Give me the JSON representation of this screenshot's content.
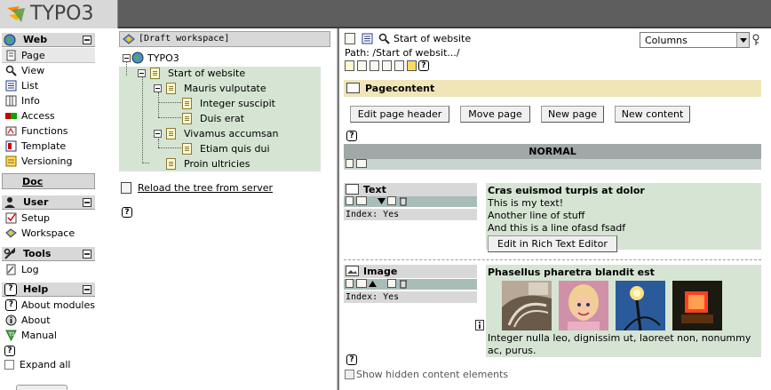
{
  "app": {
    "logo_text": "TYPO3"
  },
  "modules": {
    "web": {
      "label": "Web",
      "items": [
        {
          "label": "Page"
        },
        {
          "label": "View"
        },
        {
          "label": "List"
        },
        {
          "label": "Info"
        },
        {
          "label": "Access"
        },
        {
          "label": "Functions"
        },
        {
          "label": "Template"
        },
        {
          "label": "Versioning"
        }
      ]
    },
    "doc": {
      "label": "Doc"
    },
    "user": {
      "label": "User",
      "items": [
        {
          "label": "Setup"
        },
        {
          "label": "Workspace"
        }
      ]
    },
    "tools": {
      "label": "Tools",
      "items": [
        {
          "label": "Log"
        }
      ]
    },
    "help": {
      "label": "Help",
      "items": [
        {
          "label": "About modules"
        },
        {
          "label": "About"
        },
        {
          "label": "Manual"
        }
      ]
    },
    "expand_all": "Expand all",
    "help_icon_label": "?"
  },
  "tree": {
    "workspace": "[Draft workspace]",
    "nodes": {
      "root": "TYPO3",
      "start": "Start of website",
      "mauris": "Mauris vulputate",
      "integer": "Integer suscipit",
      "duis": "Duis erat",
      "vivamus": "Vivamus accumsan",
      "etiam": "Etiam quis dui",
      "proin": "Proin ultricies"
    },
    "reload": "Reload the tree from server"
  },
  "content": {
    "title": "Start of website",
    "path": "Path: /Start of websit.../",
    "view_select": "Columns",
    "pagecontent": "Pagecontent",
    "buttons": {
      "edit_header": "Edit page header",
      "move_page": "Move page",
      "new_page": "New page",
      "new_content": "New content"
    },
    "column": "NORMAL",
    "elements": [
      {
        "type": "Text",
        "index": "Index: Yes",
        "heading": "Cras euismod turpis at dolor",
        "lines": [
          "This is my text!",
          "Another line of stuff",
          "And this is a line ofasd fsadf"
        ],
        "rte_button": "Edit in Rich Text Editor"
      },
      {
        "type": "Image",
        "index": "Index: Yes",
        "heading": "Phasellus pharetra blandit est",
        "caption": "Integer nulla leo, dignissim ut, laoreet non, nonummy ac, purus."
      }
    ],
    "show_hidden": "Show hidden content elements"
  },
  "colors": {
    "topbar": "#585858",
    "menu_header": "#d8d8d8",
    "tree_highlight": "#d6e4d4",
    "pagecontent_bar": "#efe5b7",
    "column_bar": "#a0a8a8"
  }
}
